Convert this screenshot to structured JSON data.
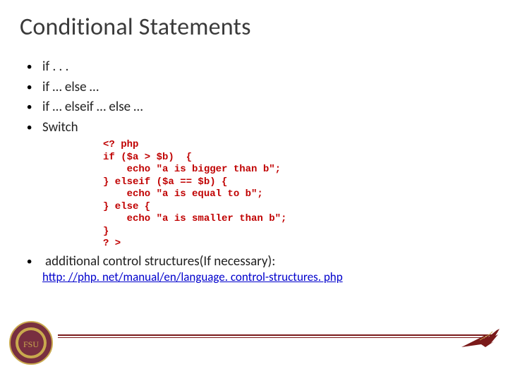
{
  "title": "Conditional Statements",
  "bullets": {
    "items": [
      "if . . .",
      "if … else …",
      "if … elseif … else …",
      "Switch"
    ]
  },
  "code": "<? php\nif ($a > $b)  {\n    echo \"a is bigger than b\";\n} elseif ($a == $b) {\n    echo \"a is equal to b\";\n} else {\n    echo \"a is smaller than b\";\n}\n? >",
  "additional": "additional control structures(If necessary):",
  "link": "http: //php. net/manual/en/language. control-structures. php"
}
